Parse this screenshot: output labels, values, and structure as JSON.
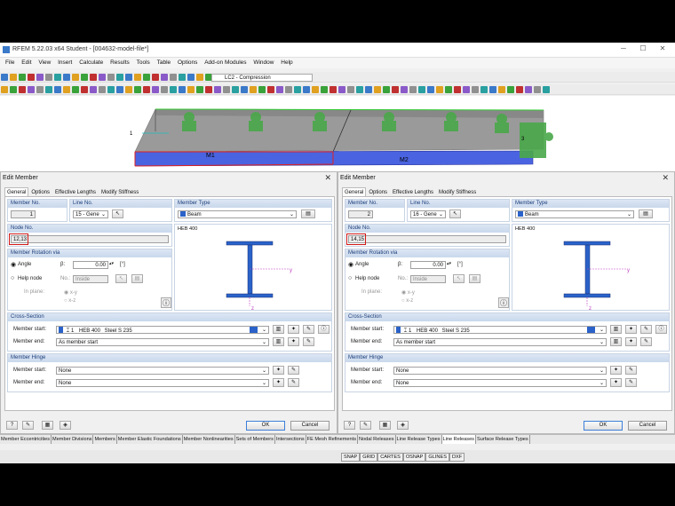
{
  "window": {
    "title": "RFEM 5.22.03 x64 Student - [004632-model-file*]"
  },
  "menu": [
    "File",
    "Edit",
    "View",
    "Insert",
    "Calculate",
    "Results",
    "Tools",
    "Table",
    "Options",
    "Add-on Modules",
    "Window",
    "Help"
  ],
  "toolbar": {
    "loadcase": "LC2 - Compression"
  },
  "model": {
    "member_labels": [
      "M1",
      "M2"
    ],
    "node_labels": [
      "1",
      "3"
    ]
  },
  "dialogs": [
    {
      "title": "Edit Member",
      "tabs": [
        "General",
        "Options",
        "Effective Lengths",
        "Modify Stiffness"
      ],
      "member_no_label": "Member No.",
      "member_no": "1",
      "line_no_label": "Line No.",
      "line_no": "15 - Gene",
      "member_type_label": "Member Type",
      "member_type": "Beam",
      "node_no_label": "Node No.",
      "node_no": "12,13",
      "section_name": "HEB 400",
      "rotation": {
        "header": "Member Rotation via",
        "angle_label": "Angle",
        "beta_label": "β:",
        "beta_value": "0.00",
        "beta_unit": "[°]",
        "help_node_label": "Help node",
        "no_label": "No.:",
        "no_value": "Inside",
        "inplane_label": "In plane:",
        "xy": "x-y",
        "xz": "x-z"
      },
      "cross_section": {
        "header": "Cross-Section",
        "start_label": "Member start:",
        "start_num": "1",
        "start_section": "HEB 400",
        "start_material": "Steel S 235",
        "end_label": "Member end:",
        "end_value": "As member start"
      },
      "hinge": {
        "header": "Member Hinge",
        "start_label": "Member start:",
        "start_value": "None",
        "end_label": "Member end:",
        "end_value": "None"
      },
      "ok": "OK",
      "cancel": "Cancel",
      "axis_y": "y",
      "axis_z": "z"
    },
    {
      "title": "Edit Member",
      "tabs": [
        "General",
        "Options",
        "Effective Lengths",
        "Modify Stiffness"
      ],
      "member_no_label": "Member No.",
      "member_no": "2",
      "line_no_label": "Line No.",
      "line_no": "16 - Gene",
      "member_type_label": "Member Type",
      "member_type": "Beam",
      "node_no_label": "Node No.",
      "node_no": "14,15",
      "section_name": "HEB 400",
      "rotation": {
        "header": "Member Rotation via",
        "angle_label": "Angle",
        "beta_label": "β:",
        "beta_value": "0.00",
        "beta_unit": "[°]",
        "help_node_label": "Help node",
        "no_label": "No.:",
        "no_value": "Inside",
        "inplane_label": "In plane:",
        "xy": "x-y",
        "xz": "x-z"
      },
      "cross_section": {
        "header": "Cross-Section",
        "start_label": "Member start:",
        "start_num": "1",
        "start_section": "HEB 400",
        "start_material": "Steel S 235",
        "end_label": "Member end:",
        "end_value": "As member start"
      },
      "hinge": {
        "header": "Member Hinge",
        "start_label": "Member start:",
        "start_value": "None",
        "end_label": "Member end:",
        "end_value": "None"
      },
      "ok": "OK",
      "cancel": "Cancel",
      "axis_y": "y",
      "axis_z": "z"
    }
  ],
  "bottom_tabs": [
    "Member Eccentricities",
    "Member Divisions",
    "Members",
    "Member Elastic Foundations",
    "Member Nonlinearities",
    "Sets of Members",
    "Intersections",
    "FE Mesh Refinements",
    "Nodal Releases",
    "Line Release Types",
    "Line Releases",
    "Surface Release Types"
  ],
  "bottom_tabs_active": "Line Releases",
  "status": [
    "SNAP",
    "GRID",
    "CARTES",
    "OSNAP",
    "GLINES",
    "DXF"
  ],
  "colors": {
    "accent": "#2a62c9",
    "highlight": "#d01818",
    "section_header": "#1a3c78",
    "support": "#3aa23a"
  }
}
